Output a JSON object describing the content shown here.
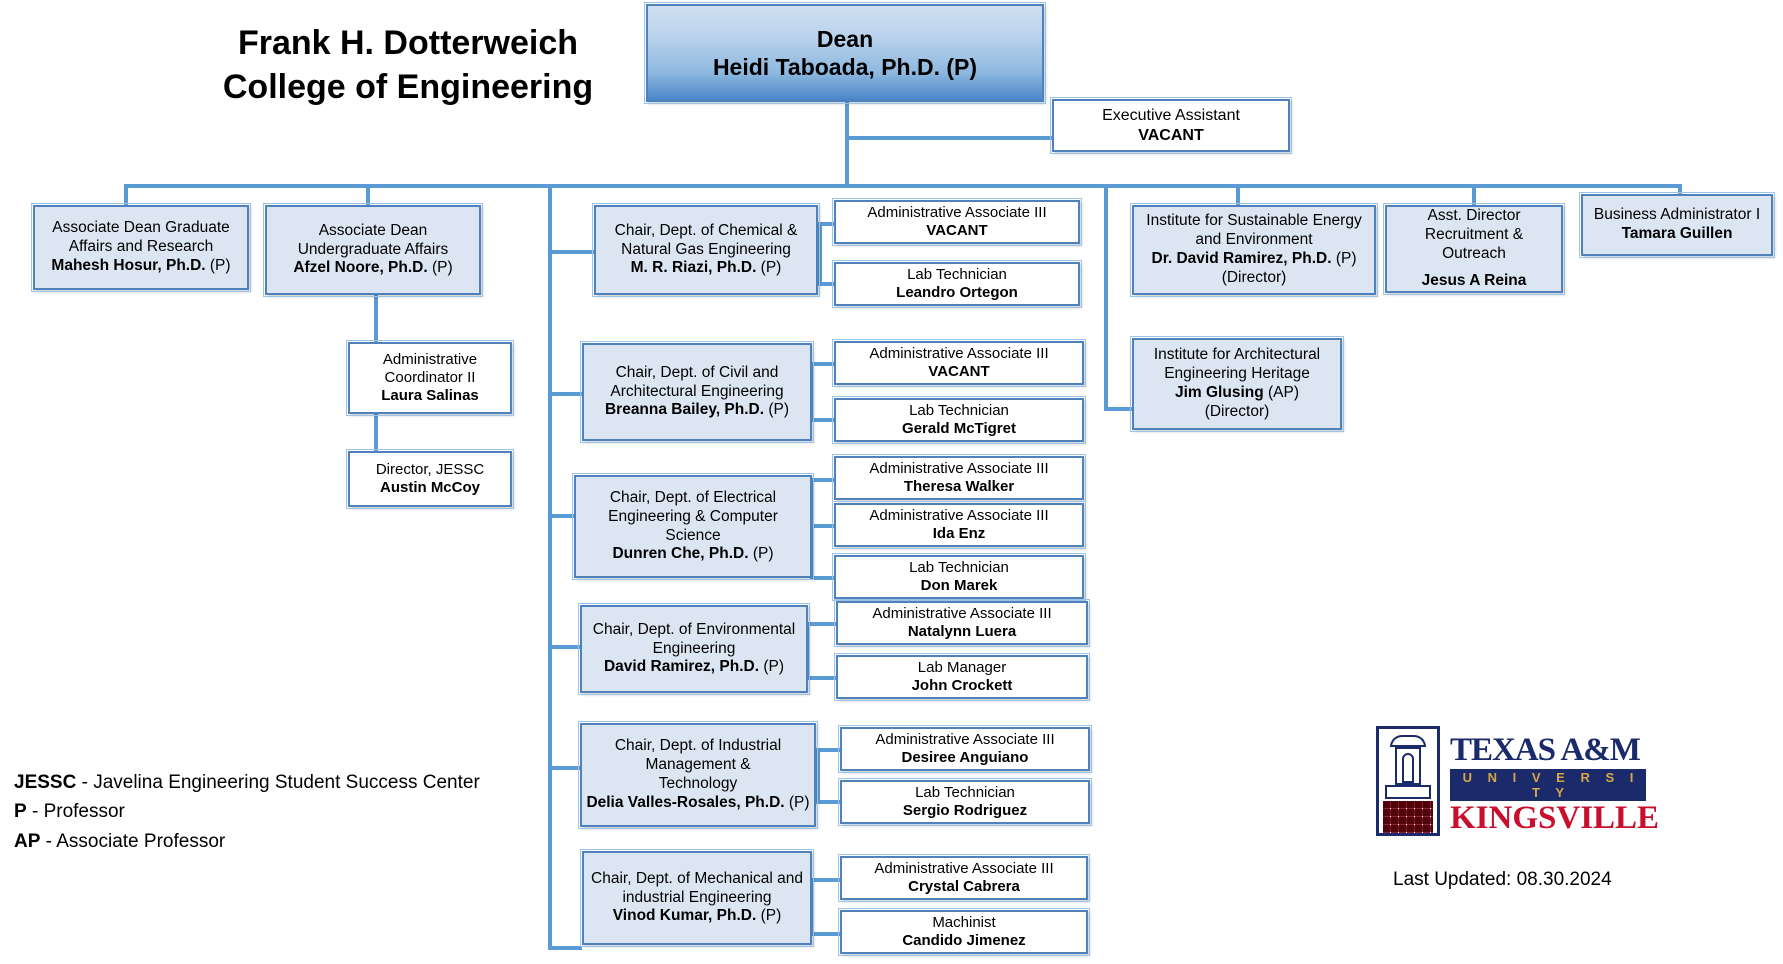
{
  "title": {
    "line1": "Frank H. Dotterweich",
    "line2": "College of Engineering"
  },
  "dean": {
    "role": "Dean",
    "name": "Heidi Taboada, Ph.D. (P)"
  },
  "exec_assistant": {
    "role": "Executive Assistant",
    "name": "VACANT"
  },
  "associate_deans": [
    {
      "role_line1": "Associate Dean Graduate",
      "role_line2": "Affairs and Research",
      "name": "Mahesh Hosur, Ph.D.",
      "suffix": " (P)"
    },
    {
      "role_line1": "Associate Dean",
      "role_line2": "Undergraduate Affairs",
      "name": "Afzel Noore, Ph.D.",
      "suffix": " (P)"
    }
  ],
  "assoc_dean_reports": [
    {
      "role_line1": "Administrative",
      "role_line2": "Coordinator II",
      "name": "Laura Salinas"
    },
    {
      "role_line1": "Director, JESSC",
      "role_line2": "",
      "name": "Austin McCoy"
    }
  ],
  "departments": [
    {
      "role_line1": "Chair, Dept. of Chemical &",
      "role_line2": "Natural Gas Engineering",
      "role_line3": "",
      "name": "M. R. Riazi, Ph.D.",
      "suffix": " (P)",
      "staff": [
        {
          "role": "Administrative Associate III",
          "name": "VACANT"
        },
        {
          "role": "Lab Technician",
          "name": "Leandro Ortegon"
        }
      ]
    },
    {
      "role_line1": "Chair, Dept. of Civil and",
      "role_line2": "Architectural Engineering",
      "role_line3": "",
      "name": "Breanna Bailey, Ph.D.",
      "suffix": " (P)",
      "staff": [
        {
          "role": "Administrative Associate III",
          "name": "VACANT"
        },
        {
          "role": "Lab Technician",
          "name": "Gerald McTigret"
        }
      ]
    },
    {
      "role_line1": "Chair, Dept. of Electrical",
      "role_line2": "Engineering & Computer Science",
      "role_line3": "",
      "name": "Dunren Che, Ph.D.",
      "suffix": " (P)",
      "staff": [
        {
          "role": "Administrative Associate III",
          "name": "Theresa Walker"
        },
        {
          "role": "Administrative Associate III",
          "name": "Ida Enz"
        },
        {
          "role": "Lab Technician",
          "name": "Don Marek"
        }
      ]
    },
    {
      "role_line1": "Chair, Dept. of Environmental",
      "role_line2": "Engineering",
      "role_line3": "",
      "name": "David Ramirez, Ph.D.",
      "suffix": " (P)",
      "staff": [
        {
          "role": "Administrative Associate III",
          "name": "Natalynn Luera"
        },
        {
          "role": "Lab Manager",
          "name": "John Crockett"
        }
      ]
    },
    {
      "role_line1": "Chair, Dept. of Industrial",
      "role_line2": "Management &",
      "role_line3": "Technology",
      "name": "Delia Valles-Rosales, Ph.D.",
      "suffix": " (P)",
      "staff": [
        {
          "role": "Administrative Associate III",
          "name": "Desiree Anguiano"
        },
        {
          "role": "Lab Technician",
          "name": "Sergio Rodriguez"
        }
      ]
    },
    {
      "role_line1": "Chair, Dept. of Mechanical and",
      "role_line2": "industrial Engineering",
      "role_line3": "",
      "name": "Vinod Kumar, Ph.D.",
      "suffix": " (P)",
      "staff": [
        {
          "role": "Administrative Associate III",
          "name": "Crystal Cabrera"
        },
        {
          "role": "Machinist",
          "name": "Candido Jimenez"
        }
      ]
    }
  ],
  "institutes": [
    {
      "role_line1": "Institute for Sustainable Energy",
      "role_line2": "and Environment",
      "name": "Dr. David Ramirez, Ph.D.",
      "suffix": " (P)",
      "sub": "(Director)"
    },
    {
      "role_line1": "Institute for Architectural",
      "role_line2": "Engineering Heritage",
      "name": "Jim Glusing",
      "suffix": " (AP)",
      "sub": "(Director)"
    }
  ],
  "right_nodes": [
    {
      "role_line1": "Asst.  Director",
      "role_line2": "Recruitment & Outreach",
      "name": "Jesus A Reina"
    },
    {
      "role_line1": "Business Administrator I",
      "role_line2": "",
      "name": "Tamara Guillen"
    }
  ],
  "legend": [
    {
      "key": "JESSC",
      "dash": " - ",
      "text": "Javelina Engineering Student Success Center"
    },
    {
      "key": "P",
      "dash": " - ",
      "text": "Professor"
    },
    {
      "key": "AP",
      "dash": " - ",
      "text": "Associate Professor"
    }
  ],
  "logo": {
    "line1": "TEXAS A&M",
    "line2": "U N I V E R S I T Y",
    "line3": "KINGSVILLE"
  },
  "last_updated": "Last Updated: 08.30.2024",
  "colors": {
    "box_fill": "#dce6f2",
    "box_border": "#4f81bd",
    "connector": "#5b9bd5",
    "logo_navy": "#1b2a6b",
    "logo_red": "#c8102e",
    "logo_gold": "#d6a74a"
  }
}
